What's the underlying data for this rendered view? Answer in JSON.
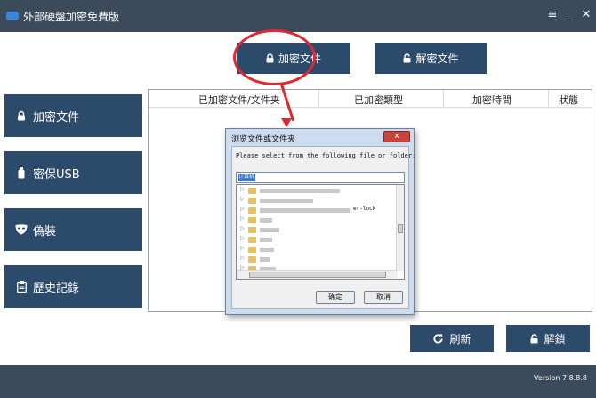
{
  "titlebar": {
    "title": "外部硬盤加密免費版",
    "menu_glyph": "≡",
    "minimize_glyph": "_",
    "close_glyph": "✕"
  },
  "toolbar": {
    "encrypt_label": "加密文件",
    "decrypt_label": "解密文件"
  },
  "sidebar": {
    "items": [
      {
        "label": "加密文件",
        "icon": "lock-icon"
      },
      {
        "label": "密保USB",
        "icon": "usb-icon"
      },
      {
        "label": "偽裝",
        "icon": "mask-icon"
      },
      {
        "label": "歷史記錄",
        "icon": "history-icon"
      }
    ]
  },
  "table": {
    "columns": [
      "已加密文件/文件夹",
      "已加密類型",
      "加密時間",
      "狀態"
    ]
  },
  "dialog": {
    "title": "浏览文件或文件夹",
    "close_glyph": "x",
    "prompt": "Please select from the following file or folder:",
    "path_value": "计算机",
    "tree_fragment": "er-lock",
    "ok_label": "确定",
    "cancel_label": "取消"
  },
  "bottom": {
    "refresh_label": "刷新",
    "unlock_label": "解鎖"
  },
  "footer": {
    "version": "Version 7.8.8.8"
  },
  "colors": {
    "titlebar": "#3b4b5c",
    "button": "#2c4a6a",
    "annotation": "#e0282e"
  }
}
